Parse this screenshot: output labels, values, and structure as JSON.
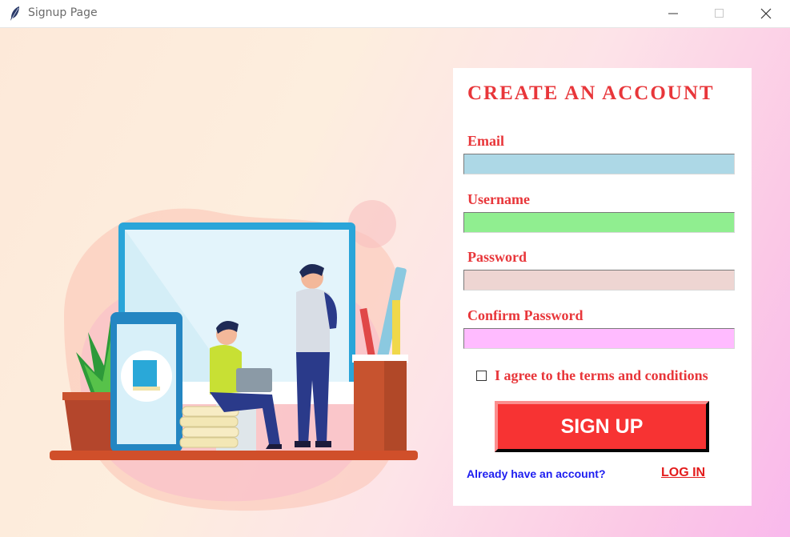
{
  "window": {
    "title": "Signup Page",
    "icons": [
      "feather-icon",
      "minimize-icon",
      "maximize-icon",
      "close-icon"
    ]
  },
  "form": {
    "heading": "CREATE AN ACCOUNT",
    "fields": [
      {
        "label": "Email",
        "value": "",
        "color": "#add8e6"
      },
      {
        "label": "Username",
        "value": "",
        "color": "#90ee90"
      },
      {
        "label": "Password",
        "value": "",
        "color": "#eed5d2"
      },
      {
        "label": "Confirm Password",
        "value": "",
        "color": "#ffbbff"
      }
    ],
    "terms_label": "I agree to the terms and conditions",
    "terms_checked": false,
    "signup_label": "SIGN UP",
    "already_text": "Already have an account?",
    "login_label": "LOG IN"
  },
  "colors": {
    "accent_red": "#e8363a",
    "button_red": "#f73333",
    "link_blue": "#1d1df0"
  }
}
